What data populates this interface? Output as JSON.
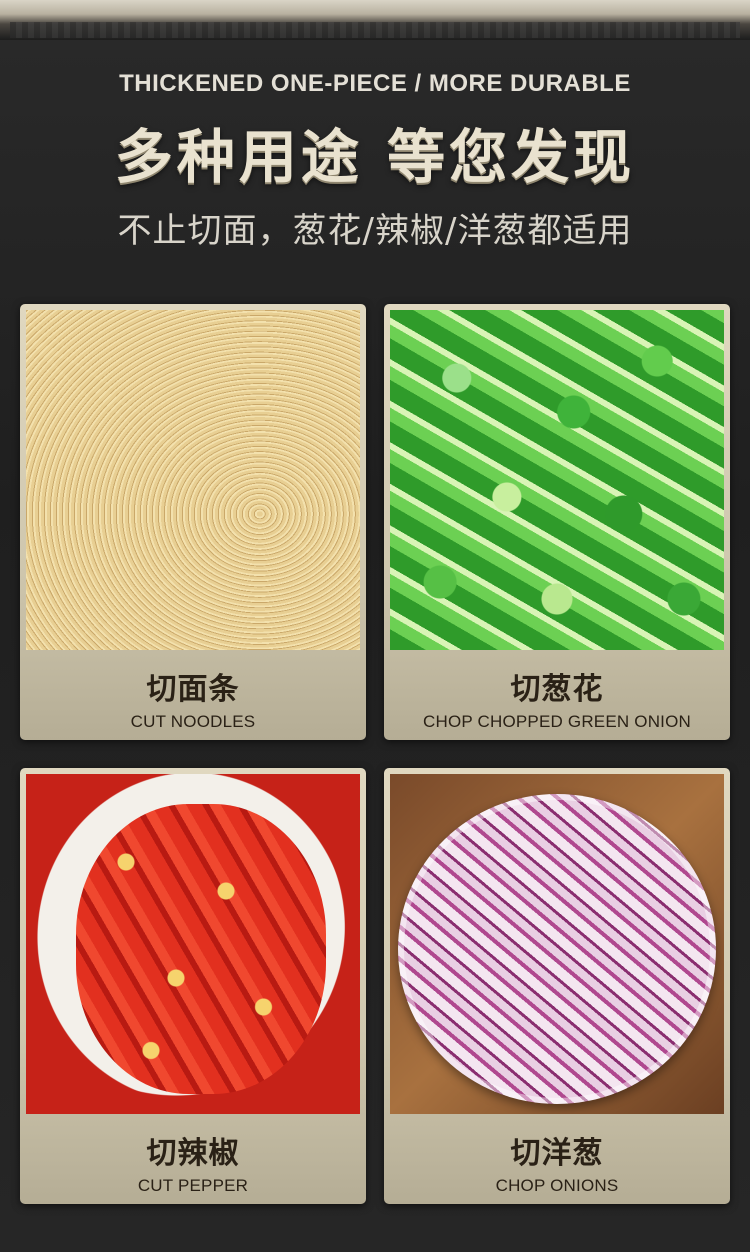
{
  "header": {
    "subtitle_en": "THICKENED ONE-PIECE / MORE DURABLE",
    "headline": "多种用途 等您发现",
    "tagline": "不止切面，葱花/辣椒/洋葱都适用"
  },
  "cards": [
    {
      "title_zh": "切面条",
      "title_en": "CUT NOODLES",
      "image": "noodles-photo"
    },
    {
      "title_zh": "切葱花",
      "title_en": "CHOP CHOPPED GREEN ONION",
      "image": "green-onion-photo"
    },
    {
      "title_zh": "切辣椒",
      "title_en": "CUT PEPPER",
      "image": "chili-pepper-photo"
    },
    {
      "title_zh": "切洋葱",
      "title_en": "CHOP ONIONS",
      "image": "red-onion-photo"
    }
  ]
}
